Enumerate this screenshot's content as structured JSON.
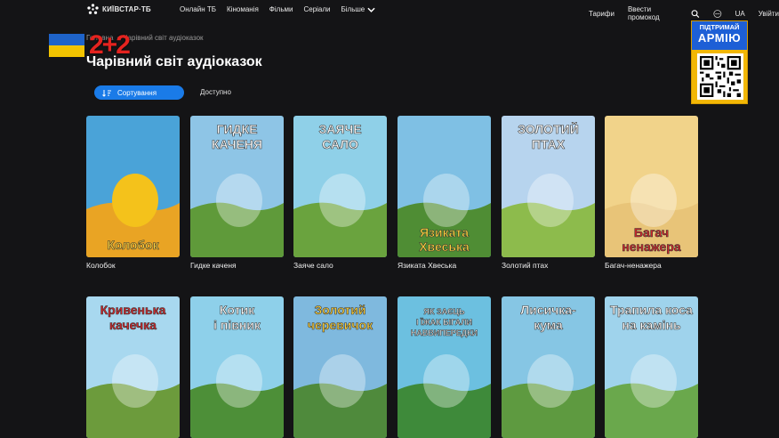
{
  "topbar": {
    "logo_text": "КИЇВСТАР·ТБ",
    "nav": [
      "Онлайн ТБ",
      "Кіноманія",
      "Фільми",
      "Серіали"
    ],
    "more_label": "Більше",
    "tariffs": "Тарифи",
    "promo": "Ввести промокод",
    "lang": "UA",
    "login": "Увійти"
  },
  "overlay": {
    "channel_logo": "2+2",
    "badge_line1": "ПІДТРИМАЙ",
    "badge_line2": "АРМІЮ"
  },
  "breadcrumb": {
    "home": "Головна",
    "current": "Чарівний світ аудіоказок"
  },
  "page_title": "Чарівний світ аудіоказок",
  "filters": {
    "sort_label": "Сортування",
    "available_label": "Доступно"
  },
  "cards": [
    {
      "title": "Колобок",
      "cover_text": [
        "Колобок"
      ],
      "bg": "#4aa3d8"
    },
    {
      "title": "Гидке каченя",
      "cover_text": [
        "ГИДКЕ",
        "КАЧЕНЯ"
      ],
      "bg": "#8ec5e6"
    },
    {
      "title": "Заяче сало",
      "cover_text": [
        "ЗАЯЧЕ",
        "САЛО"
      ],
      "bg": "#8fd0e8"
    },
    {
      "title": "Язиката Хвеська",
      "cover_text": [
        "Язиката",
        "Хвеська"
      ],
      "bg": "#7fc0e4"
    },
    {
      "title": "Золотий птах",
      "cover_text": [
        "ЗОЛОТИЙ",
        "ПТАХ"
      ],
      "bg": "#b7d4ee"
    },
    {
      "title": "Багач-ненажера",
      "cover_text": [
        "Багач",
        "ненажера"
      ],
      "bg": "#f1d38a"
    },
    {
      "title": "",
      "cover_text": [
        "Кривенька",
        "качечка"
      ],
      "bg": "#a8d8ef"
    },
    {
      "title": "",
      "cover_text": [
        "Котик",
        "і півник"
      ],
      "bg": "#8ed0ea"
    },
    {
      "title": "",
      "cover_text": [
        "Золотий",
        "черевичок"
      ],
      "bg": "#7fb9de"
    },
    {
      "title": "",
      "cover_text": [
        "ЯК ЗАЄЦЬ",
        "І ЇЖАК БІГАЛИ",
        "НАВВИПЕРЕДКИ"
      ],
      "bg": "#6cc0e0"
    },
    {
      "title": "",
      "cover_text": [
        "Лисичка-",
        "кума"
      ],
      "bg": "#86c6e4"
    },
    {
      "title": "",
      "cover_text": [
        "Трапила коса",
        "на камінь"
      ],
      "bg": "#9fd3ec"
    }
  ],
  "colors": {
    "background": "#141416",
    "accent": "#1a7be8",
    "badge_blue": "#1d5fd6",
    "badge_yellow": "#f2b705",
    "channel_red": "#e4231f"
  }
}
